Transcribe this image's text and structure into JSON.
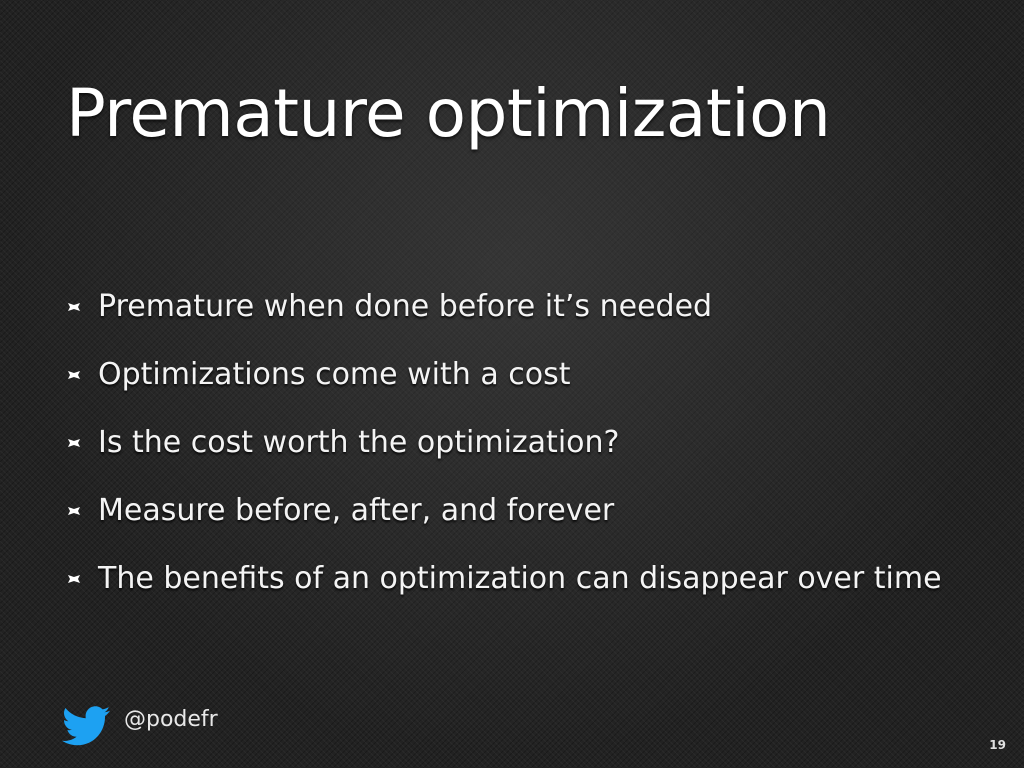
{
  "slide": {
    "title": "Premature optimization",
    "bullets": [
      "Premature when done before it’s needed",
      "Optimizations come with a cost",
      "Is the cost worth the optimization?",
      "Measure before, after, and forever",
      "The benefits of an optimization can disappear over time"
    ],
    "bullet_icon": "bullet-marker-icon",
    "footer": {
      "icon": "twitter-bird-icon",
      "icon_color": "#1da1f2",
      "handle": "@podefr"
    },
    "slide_number": "19"
  }
}
